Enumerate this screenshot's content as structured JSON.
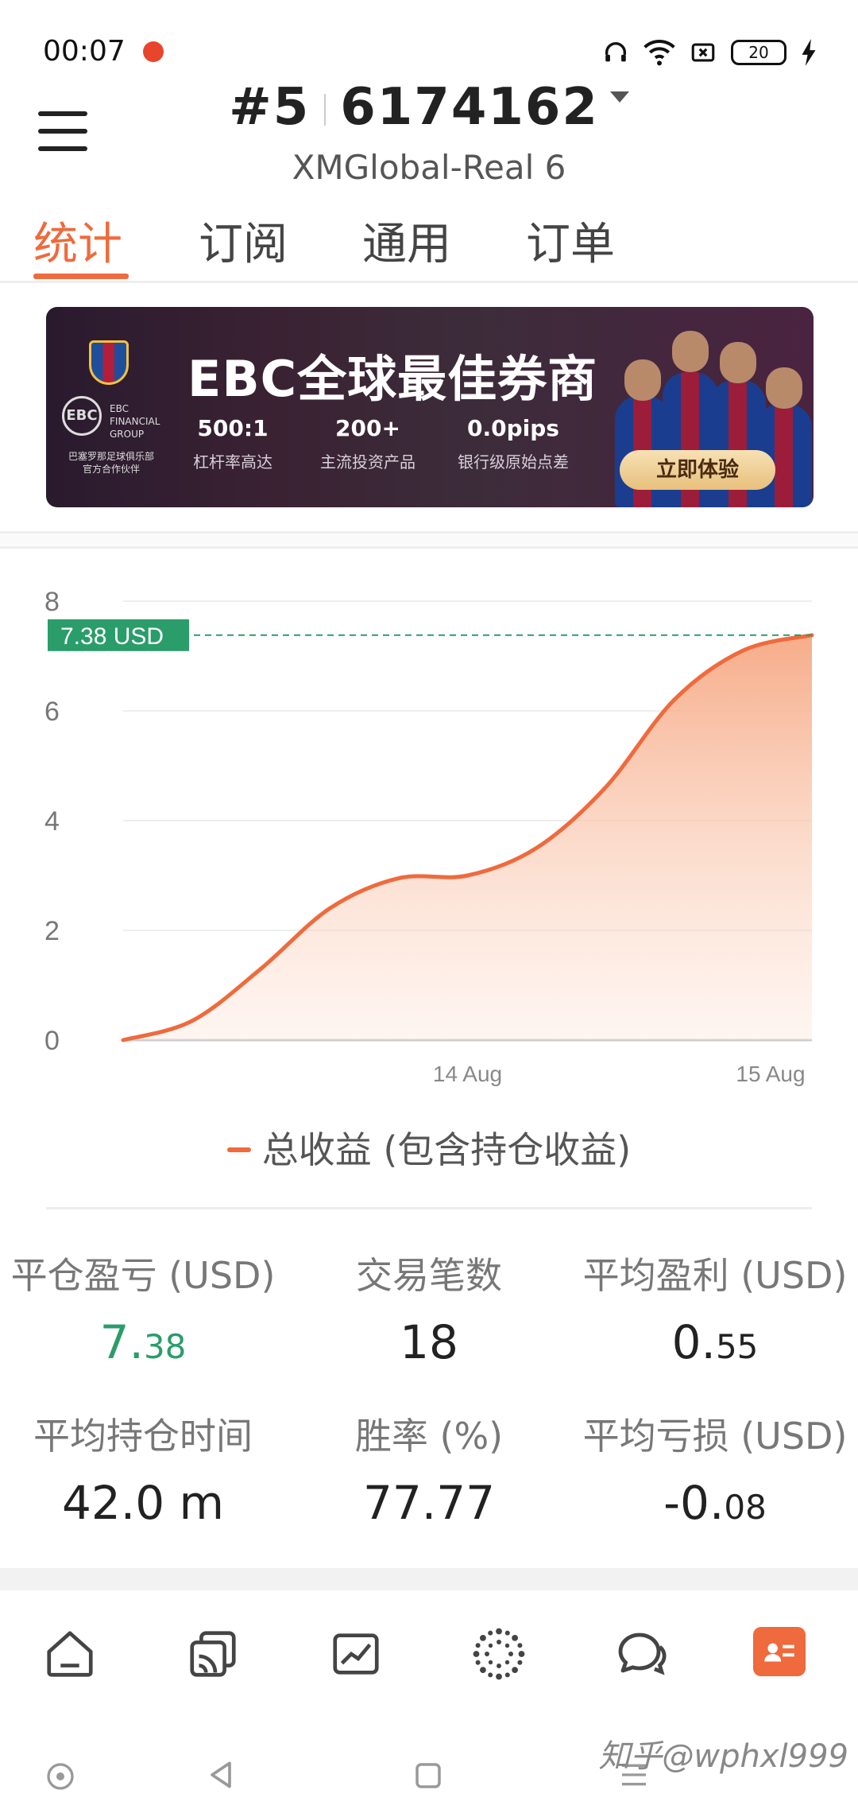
{
  "status_bar": {
    "time": "00:07",
    "battery": "20"
  },
  "header": {
    "account_prefix": "#5",
    "account_number": "6174162",
    "server": "XMGlobal-Real 6"
  },
  "tabs": [
    {
      "label": "统计",
      "active": true
    },
    {
      "label": "订阅",
      "active": false
    },
    {
      "label": "通用",
      "active": false
    },
    {
      "label": "订单",
      "active": false
    }
  ],
  "banner": {
    "title": "EBC全球最佳券商",
    "logo_text": "EBC",
    "logo_sub": "EBC FINANCIAL GROUP",
    "partner_text": "巴塞罗那足球俱乐部 官方合作伙伴",
    "stats": [
      {
        "value": "500:1",
        "label": "杠杆率高达"
      },
      {
        "value": "200+",
        "label": "主流投资产品"
      },
      {
        "value": "0.0pips",
        "label": "银行级原始点差"
      }
    ],
    "cta": "立即体验"
  },
  "chart_data": {
    "type": "area",
    "y_ticks": [
      "8",
      "6",
      "4",
      "2",
      "0"
    ],
    "ylim": [
      0,
      8
    ],
    "x_ticks": [
      "14 Aug",
      "15 Aug"
    ],
    "current_value_label": "7.38 USD",
    "current_value": 7.38,
    "series": [
      {
        "name": "总收益 (包含持仓收益)",
        "x": [
          0,
          0.1,
          0.2,
          0.3,
          0.4,
          0.5,
          0.6,
          0.7,
          0.8,
          0.9,
          1.0
        ],
        "values": [
          0,
          0.35,
          1.3,
          2.4,
          2.95,
          3.0,
          3.5,
          4.6,
          6.2,
          7.1,
          7.38
        ]
      }
    ],
    "grid": true,
    "colors": {
      "line": "#ef6a3c",
      "fill": "#f8b89a",
      "label_bg": "#2a9d6a"
    }
  },
  "stats": [
    {
      "label": "平仓盈亏 (USD)",
      "value_main": "7.",
      "value_small": "38",
      "color": "green"
    },
    {
      "label": "交易笔数",
      "value_main": "18",
      "value_small": ""
    },
    {
      "label": "平均盈利 (USD)",
      "value_main": "0.",
      "value_small": "55"
    },
    {
      "label": "平均持仓时间",
      "value_main": "42.0 m",
      "value_small": ""
    },
    {
      "label": "胜率 (%)",
      "value_main": "77.77",
      "value_small": ""
    },
    {
      "label": "平均亏损 (USD)",
      "value_main": "-0.",
      "value_small": "08"
    }
  ],
  "bottom_nav": [
    "home-icon",
    "copy-signal-icon",
    "chart-icon",
    "community-icon",
    "chat-icon",
    "profile-card-icon"
  ],
  "watermark": "知乎@wphxl999"
}
